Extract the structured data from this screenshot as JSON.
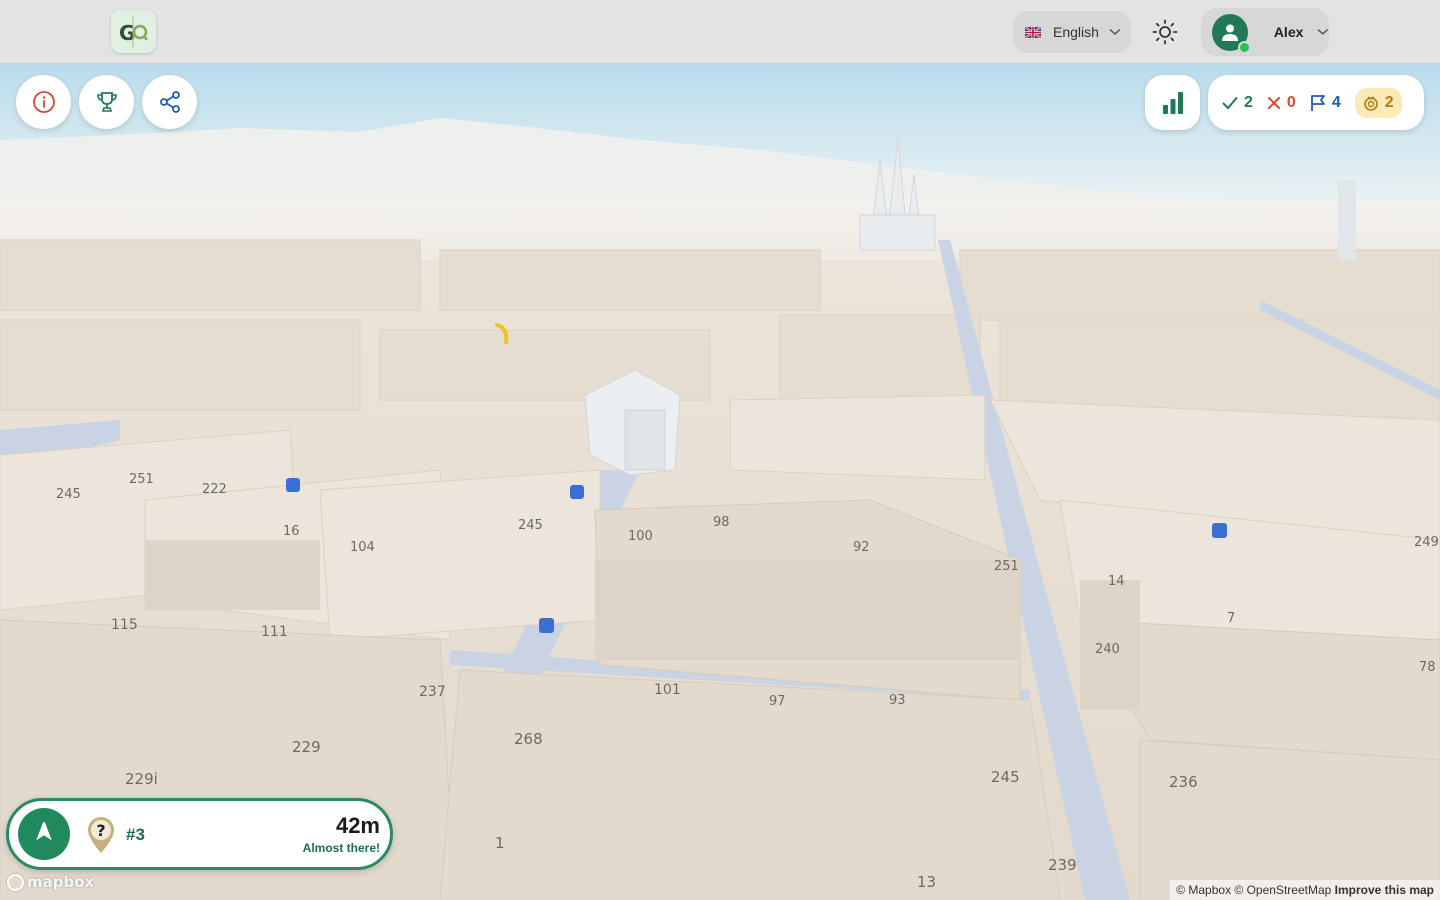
{
  "header": {
    "language": {
      "label": "English"
    },
    "user": {
      "name": "Alex"
    }
  },
  "toolbar": {
    "info_icon": "info-icon",
    "trophy_icon": "trophy-icon",
    "share_icon": "share-icon",
    "stats_icon": "bar-chart-icon"
  },
  "score": {
    "correct": "2",
    "wrong": "0",
    "flags": "4",
    "hints": "2"
  },
  "navigation": {
    "stop": "#3",
    "distance": "42m",
    "status": "Almost there!"
  },
  "map": {
    "labels": [
      {
        "text": "251"
      },
      {
        "text": "245"
      },
      {
        "text": "222"
      },
      {
        "text": "16"
      },
      {
        "text": "104"
      },
      {
        "text": "245"
      },
      {
        "text": "100"
      },
      {
        "text": "98"
      },
      {
        "text": "92"
      },
      {
        "text": "251"
      },
      {
        "text": "14"
      },
      {
        "text": "249"
      },
      {
        "text": "7"
      },
      {
        "text": "115"
      },
      {
        "text": "111"
      },
      {
        "text": "237"
      },
      {
        "text": "101"
      },
      {
        "text": "97"
      },
      {
        "text": "93"
      },
      {
        "text": "240"
      },
      {
        "text": "78"
      },
      {
        "text": "268"
      },
      {
        "text": "229"
      },
      {
        "text": "229i"
      },
      {
        "text": "245"
      },
      {
        "text": "236"
      },
      {
        "text": "1"
      },
      {
        "text": "239"
      },
      {
        "text": "13"
      }
    ],
    "logo_text": "mapbox",
    "attribution": "© Mapbox © OpenStreetMap",
    "improve_link": "Improve this map"
  },
  "colors": {
    "accent": "#218a5c",
    "correct": "#1f7a55",
    "wrong": "#d64a32",
    "flag": "#1e5fa8",
    "hint": "#b77c07"
  }
}
